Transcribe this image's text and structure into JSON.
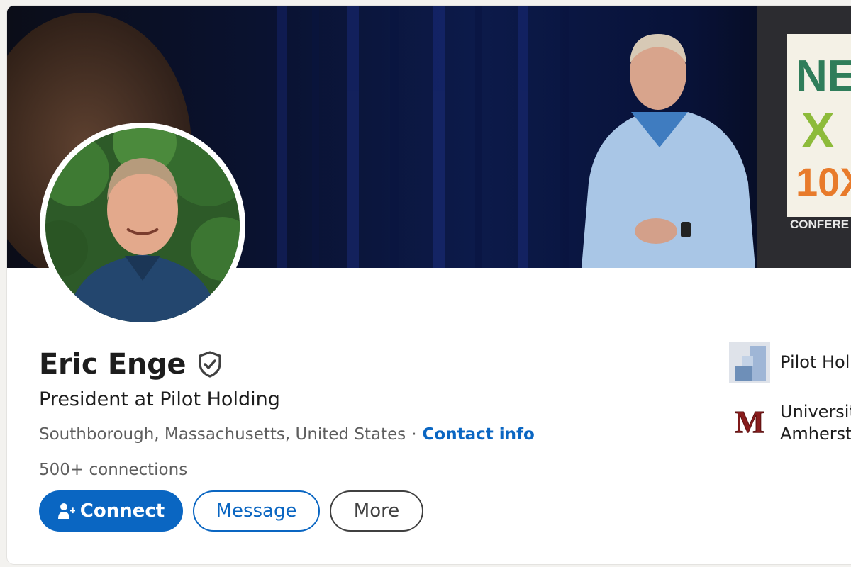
{
  "profile": {
    "name": "Eric Enge",
    "headline": "President at Pilot Holding",
    "location": "Southborough, Massachusetts, United States",
    "separator": "·",
    "contact_label": "Contact info",
    "connections": "500+ connections",
    "verified_icon": "verified-shield-icon"
  },
  "banner": {
    "sign_lines": [
      "NE",
      "X",
      "10X",
      "CONFERE"
    ]
  },
  "actions": {
    "connect_label": "Connect",
    "connect_icon": "add-person-icon",
    "message_label": "Message",
    "more_label": "More"
  },
  "sidebar": {
    "company": "Pilot Hol",
    "school_line1": "Universit",
    "school_line2": "Amherst",
    "school_logo_letter": "M"
  },
  "colors": {
    "primary": "#0a66c2",
    "text": "#1d1d1d",
    "muted": "#5e5e5e",
    "school_maroon": "#881c1c"
  }
}
